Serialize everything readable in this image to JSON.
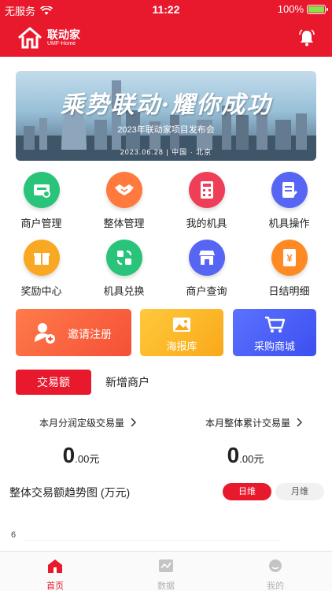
{
  "status_bar": {
    "carrier": "无服务",
    "time": "11:22",
    "battery": "100%",
    "battery_level": 1.0
  },
  "app": {
    "name": "联动家",
    "subtitle": "UMF-Home"
  },
  "banner": {
    "headline": "乘势联动·耀你成功",
    "event": "2023年联动家项目发布会",
    "date_place": "2023.06.28  |  中国 · 北京"
  },
  "menu": [
    {
      "label": "商户管理",
      "icon": "store-management-icon",
      "color": "#29c37a"
    },
    {
      "label": "整体管理",
      "icon": "handshake-icon",
      "color": "#ff7a3c"
    },
    {
      "label": "我的机具",
      "icon": "calculator-icon",
      "color": "#ef3e57"
    },
    {
      "label": "机具操作",
      "icon": "document-edit-icon",
      "color": "#5665f3"
    },
    {
      "label": "奖励中心",
      "icon": "gift-icon",
      "color": "#f9a824"
    },
    {
      "label": "机具兑换",
      "icon": "exchange-icon",
      "color": "#29c37a"
    },
    {
      "label": "商户查询",
      "icon": "shop-icon",
      "color": "#5665f3"
    },
    {
      "label": "日结明细",
      "icon": "yen-book-icon",
      "color": "#ff8a24"
    }
  ],
  "actions": {
    "invite": "邀请注册",
    "poster": "海报库",
    "purchase": "采购商城"
  },
  "tabs": {
    "transaction": "交易额",
    "new_merchants": "新增商户"
  },
  "stats": {
    "monthly_profit_label": "本月分润定级交易量",
    "monthly_profit_int": "0",
    "monthly_profit_dec": ".00元",
    "monthly_total_label": "本月整体累计交易量",
    "monthly_total_int": "0",
    "monthly_total_dec": ".00元"
  },
  "trend": {
    "title": "整体交易额趋势图 (万元)",
    "daily": "日维",
    "monthly": "月维",
    "y_tick": "6"
  },
  "tabbar": {
    "home": "首页",
    "data": "数据",
    "mine": "我的"
  },
  "colors": {
    "brand": "#e8192c"
  }
}
